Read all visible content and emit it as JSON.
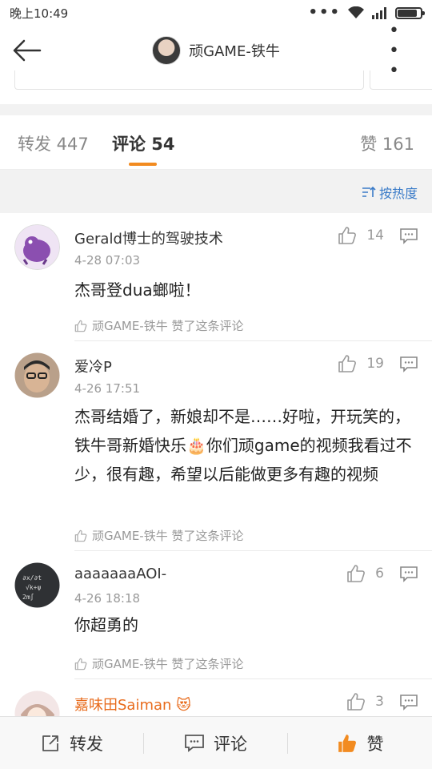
{
  "status_bar": {
    "time": "晚上10:49",
    "dots": "•••"
  },
  "header": {
    "title": "顽GAME-铁牛",
    "more": "• • •"
  },
  "tabs": [
    {
      "label": "转发 447"
    },
    {
      "label": "评论 54"
    },
    {
      "label": "赞 161"
    }
  ],
  "sort": {
    "label": "按热度"
  },
  "comments": [
    {
      "user": "Gerald博士的驾驶技术",
      "time": "4-28 07:03",
      "text": "杰哥登dua螂啦！",
      "likes": "14",
      "liked_by": "顽GAME-铁牛 赞了这条评论"
    },
    {
      "user": "爱冷P",
      "time": "4-26 17:51",
      "text": "杰哥结婚了，新娘却不是……好啦，开玩笑的，铁牛哥新婚快乐🎂你们顽game的视频我看过不少，很有趣，希望以后能做更多有趣的视频",
      "likes": "19",
      "liked_by": "顽GAME-铁牛 赞了这条评论"
    },
    {
      "user": "aaaaaaaAOI-",
      "time": "4-26 18:18",
      "text": "你超勇的",
      "likes": "6",
      "liked_by": "顽GAME-铁牛 赞了这条评论"
    },
    {
      "user": "嘉味田Saiman",
      "badge": "😻",
      "likes": "3"
    }
  ],
  "bottom_bar": {
    "repost": "转发",
    "comment": "评论",
    "like": "赞"
  },
  "colors": {
    "accent": "#f28b20",
    "link": "#3a7bc8",
    "vip": "#e86b1c"
  }
}
